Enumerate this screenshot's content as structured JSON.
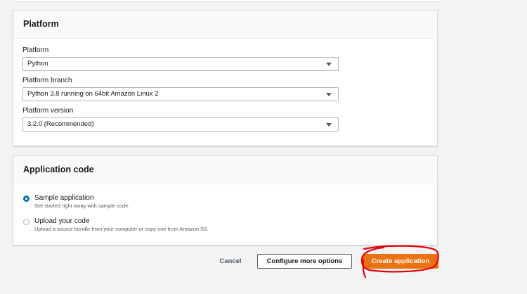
{
  "platform_section": {
    "title": "Platform",
    "platform": {
      "label": "Platform",
      "value": "Python"
    },
    "platform_branch": {
      "label": "Platform branch",
      "value": "Python 3.8 running on 64bit Amazon Linux 2"
    },
    "platform_version": {
      "label": "Platform version",
      "value": "3.2.0 (Recommended)"
    }
  },
  "application_code_section": {
    "title": "Application code",
    "options": [
      {
        "label": "Sample application",
        "description": "Get started right away with sample code.",
        "selected": true
      },
      {
        "label": "Upload your code",
        "description": "Upload a source bundle from your computer or copy one from Amazon S3.",
        "selected": false
      }
    ]
  },
  "actions": {
    "cancel_label": "Cancel",
    "configure_label": "Configure more options",
    "create_label": "Create application"
  },
  "colors": {
    "primary_button": "#ec7211",
    "radio_selected": "#0073bb",
    "annotation": "#e8000b"
  }
}
